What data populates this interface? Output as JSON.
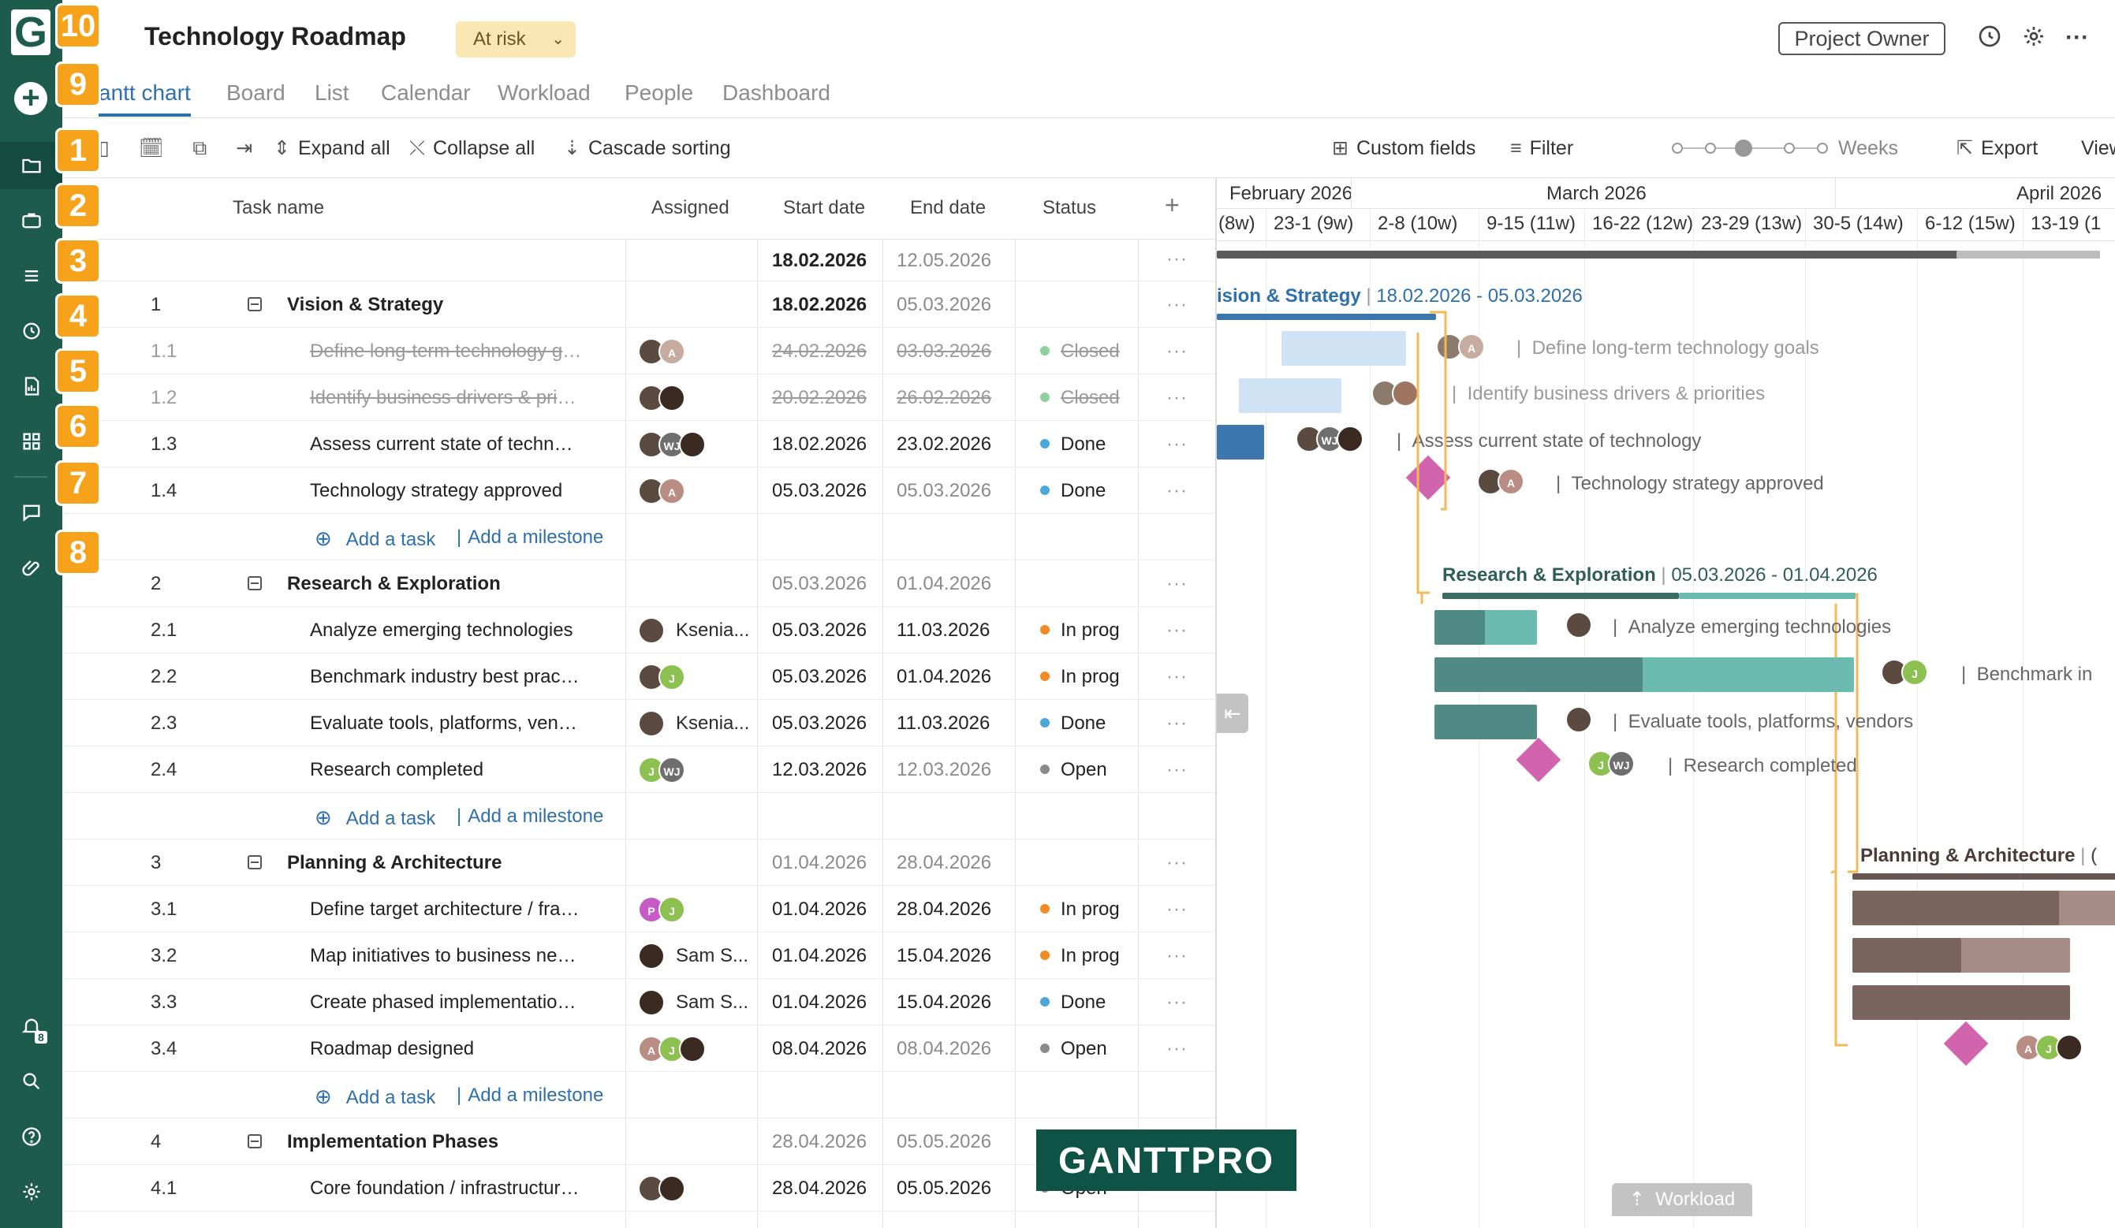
{
  "sidebar": {
    "logo": "G",
    "badges": [
      "10",
      "9",
      "1",
      "2",
      "3",
      "4",
      "5",
      "6",
      "7",
      "8"
    ],
    "notifications_count": "8"
  },
  "header": {
    "title": "Technology Roadmap",
    "status": "At risk",
    "owner_button": "Project Owner"
  },
  "tabs": [
    "antt chart",
    "Board",
    "List",
    "Calendar",
    "Workload",
    "People",
    "Dashboard"
  ],
  "toolbar": {
    "expand_all": "Expand all",
    "collapse_all": "Collapse all",
    "cascade_sorting": "Cascade sorting",
    "custom_fields": "Custom fields",
    "filter": "Filter",
    "weeks": "Weeks",
    "export": "Export",
    "view": "View"
  },
  "grid": {
    "columns": [
      "Task name",
      "Assigned",
      "Start date",
      "End date",
      "Status"
    ],
    "summary": {
      "start": "18.02.2026",
      "end": "12.05.2026"
    },
    "add_task": "Add a task",
    "add_milestone": "Add a milestone",
    "rows": [
      {
        "type": "group",
        "num": "1",
        "name": "Vision & Strategy",
        "start": "18.02.2026",
        "end": "05.03.2026"
      },
      {
        "type": "task",
        "num": "1.1",
        "name": "Define long-term technology go...",
        "start": "24.02.2026",
        "end": "03.03.2026",
        "status": "Closed",
        "status_color": "#8fd19e",
        "strike": true,
        "assigned": [
          {
            "kind": "photo"
          },
          {
            "kind": "letter",
            "text": "A",
            "color": "#c7aaa0"
          }
        ]
      },
      {
        "type": "task",
        "num": "1.2",
        "name": "Identify business drivers & priori...",
        "start": "20.02.2026",
        "end": "26.02.2026",
        "status": "Closed",
        "status_color": "#8fd19e",
        "strike": true,
        "assigned": [
          {
            "kind": "photo"
          },
          {
            "kind": "photo2"
          }
        ]
      },
      {
        "type": "task",
        "num": "1.3",
        "name": "Assess current state of technology",
        "start": "18.02.2026",
        "end": "23.02.2026",
        "status": "Done",
        "status_color": "#4aa8d8",
        "assigned": [
          {
            "kind": "photo"
          },
          {
            "kind": "letter",
            "text": "WJ",
            "color": "#6e6e6e"
          },
          {
            "kind": "photo2"
          }
        ]
      },
      {
        "type": "task",
        "num": "1.4",
        "name": "Technology strategy approved",
        "start": "05.03.2026",
        "end": "05.03.2026",
        "end_gray": true,
        "status": "Done",
        "status_color": "#4aa8d8",
        "assigned": [
          {
            "kind": "photo"
          },
          {
            "kind": "letter",
            "text": "A",
            "color": "#b98d84"
          }
        ]
      },
      {
        "type": "add"
      },
      {
        "type": "group",
        "num": "2",
        "name": "Research & Exploration",
        "start": "05.03.2026",
        "end": "01.04.2026",
        "gray_dates": true
      },
      {
        "type": "task",
        "num": "2.1",
        "name": "Analyze emerging technologies",
        "start": "05.03.2026",
        "end": "11.03.2026",
        "status": "In prog",
        "status_color": "#f08a24",
        "assigned": [
          {
            "kind": "photo"
          }
        ],
        "assigned_text": "Ksenia..."
      },
      {
        "type": "task",
        "num": "2.2",
        "name": "Benchmark industry best practic...",
        "start": "05.03.2026",
        "end": "01.04.2026",
        "status": "In prog",
        "status_color": "#f08a24",
        "assigned": [
          {
            "kind": "photo"
          },
          {
            "kind": "letter",
            "text": "J",
            "color": "#8cc152"
          }
        ]
      },
      {
        "type": "task",
        "num": "2.3",
        "name": "Evaluate tools, platforms, vendors",
        "start": "05.03.2026",
        "end": "11.03.2026",
        "status": "Done",
        "status_color": "#4aa8d8",
        "assigned": [
          {
            "kind": "photo"
          }
        ],
        "assigned_text": "Ksenia..."
      },
      {
        "type": "task",
        "num": "2.4",
        "name": "Research completed",
        "start": "12.03.2026",
        "end": "12.03.2026",
        "end_gray": true,
        "status": "Open",
        "status_color": "#8a8a8a",
        "assigned": [
          {
            "kind": "letter",
            "text": "J",
            "color": "#8cc152"
          },
          {
            "kind": "letter",
            "text": "WJ",
            "color": "#6e6e6e"
          }
        ]
      },
      {
        "type": "add"
      },
      {
        "type": "group",
        "num": "3",
        "name": "Planning & Architecture",
        "start": "01.04.2026",
        "end": "28.04.2026",
        "gray_dates": true
      },
      {
        "type": "task",
        "num": "3.1",
        "name": "Define target architecture / fram...",
        "start": "01.04.2026",
        "end": "28.04.2026",
        "status": "In prog",
        "status_color": "#f08a24",
        "assigned": [
          {
            "kind": "letter",
            "text": "P",
            "color": "#c65bc6"
          },
          {
            "kind": "letter",
            "text": "J",
            "color": "#8cc152"
          }
        ]
      },
      {
        "type": "task",
        "num": "3.2",
        "name": "Map initiatives to business needs",
        "start": "01.04.2026",
        "end": "15.04.2026",
        "status": "In prog",
        "status_color": "#f08a24",
        "assigned": [
          {
            "kind": "photo2"
          }
        ],
        "assigned_text": "Sam S..."
      },
      {
        "type": "task",
        "num": "3.3",
        "name": "Create phased implementation p...",
        "start": "01.04.2026",
        "end": "15.04.2026",
        "status": "Done",
        "status_color": "#4aa8d8",
        "assigned": [
          {
            "kind": "photo2"
          }
        ],
        "assigned_text": "Sam S..."
      },
      {
        "type": "task",
        "num": "3.4",
        "name": "Roadmap designed",
        "start": "08.04.2026",
        "end": "08.04.2026",
        "end_gray": true,
        "status": "Open",
        "status_color": "#8a8a8a",
        "assigned": [
          {
            "kind": "letter",
            "text": "A",
            "color": "#b98d84"
          },
          {
            "kind": "letter",
            "text": "J",
            "color": "#8cc152"
          },
          {
            "kind": "photo2"
          }
        ]
      },
      {
        "type": "add"
      },
      {
        "type": "group",
        "num": "4",
        "name": "Implementation Phases",
        "start": "28.04.2026",
        "end": "05.05.2026",
        "gray_dates": true
      },
      {
        "type": "task",
        "num": "4.1",
        "name": "Core foundation / infrastructure...",
        "start": "28.04.2026",
        "end": "05.05.2026",
        "status": "Open",
        "status_color": "#8a8a8a",
        "assigned": [
          {
            "kind": "photo"
          },
          {
            "kind": "photo2"
          }
        ]
      }
    ]
  },
  "gantt": {
    "months": [
      {
        "label": "February 2026"
      },
      {
        "label": "March 2026"
      },
      {
        "label": "April 2026"
      }
    ],
    "weeks": [
      "(8w)",
      "23-1 (9w)",
      "2-8 (10w)",
      "9-15 (11w)",
      "16-22 (12w)",
      "23-29 (13w)",
      "30-5 (14w)",
      "6-12 (15w)",
      "13-19 (1"
    ],
    "groups": [
      {
        "name": "ision & Strategy",
        "dates": "18.02.2026 - 05.03.2026"
      },
      {
        "name": "Research & Exploration",
        "dates": "05.03.2026 - 01.04.2026"
      },
      {
        "name": "Planning & Architecture",
        "dates": "("
      }
    ],
    "task_labels": [
      "Define long-term technology goals",
      "Identify business drivers & priorities",
      "Assess current state of technology",
      "Technology strategy approved",
      "Analyze emerging technologies",
      "Benchmark in",
      "Evaluate tools, platforms, vendors",
      "Research completed"
    ],
    "workload_button": "Workload"
  },
  "watermark": "GANTTPRO",
  "colors": {
    "sidebar": "#1d5c4d",
    "accent_blue": "#2e6fae",
    "badge_orange": "#f7a21b",
    "milestone": "#d263ad",
    "research_bar": "#4f8a84",
    "research_progress": "#6cbbb0",
    "planning_bar": "#7a645e",
    "planning_progress": "#a78d86"
  }
}
